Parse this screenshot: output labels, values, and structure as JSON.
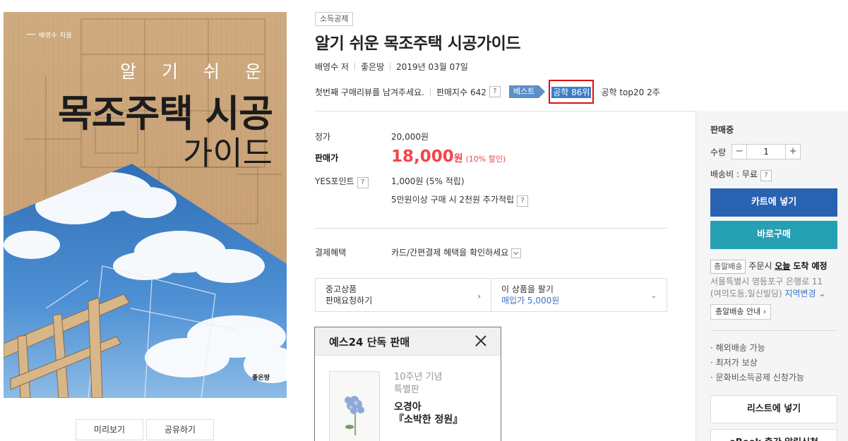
{
  "cover": {
    "author_line": "배영수 지음",
    "subtitle": "알 기 쉬 운",
    "title_line1": "목조주택 시공",
    "title_line2": "가이드",
    "publisher": "좋은땅"
  },
  "cover_buttons": {
    "preview": "미리보기",
    "share": "공유하기"
  },
  "product": {
    "tag": "소득공제",
    "title": "알기 쉬운 목조주택 시공가이드",
    "author": "배영수 저",
    "publisher": "좋은땅",
    "date": "2019년 03월 07일",
    "review_prompt": "첫번째 구매리뷰를 남겨주세요.",
    "sales_index": "판매지수 642",
    "best_label": "베스트",
    "rank": "공학 86위",
    "rank_top": "공학 top20 2주"
  },
  "price": {
    "list_label": "정가",
    "list_value": "20,000원",
    "sale_label": "판매가",
    "sale_amount": "18,000",
    "sale_unit": "원",
    "sale_rate": "(10% 할인)",
    "point_label": "YES포인트",
    "point_value": "1,000원 (5% 적립)",
    "extra_point": "5만원이상 구매 시 2천원 추가적립",
    "help": "?"
  },
  "payment": {
    "label": "결제혜택",
    "value": "카드/간편결제 혜택을 확인하세요"
  },
  "used": {
    "left_line1": "중고상품",
    "left_line2": "판매요청하기",
    "right_line1": "이 상품을 팔기",
    "right_line2": "매입가 5,000원"
  },
  "exclusive": {
    "header": "예스24 단독 판매",
    "annotation_line1": "10주년 기념",
    "annotation_line2": "특별판",
    "book_author": "오경아",
    "book_title": "『소박한 정원』"
  },
  "purchase": {
    "status": "판매중",
    "qty_label": "수량",
    "qty_value": "1",
    "minus": "−",
    "plus": "+",
    "shipping": "배송비 : 무료",
    "cart_button": "카트에 넣기",
    "buy_button": "바로구매",
    "delivery_chip": "총알배송",
    "delivery_pre": "주문시",
    "delivery_today": "오늘",
    "delivery_post": "도착 예정",
    "address_line1": "서울특별시 영등포구 은행로 11",
    "address_line2": "(여의도동,일신빌딩)",
    "address_change": "지역변경",
    "guide_button": "총알배송 안내",
    "benefits": [
      "해외배송 가능",
      "최저가 보상",
      "문화비소득공제 신청가능"
    ],
    "list_button": "리스트에 넣기",
    "ebook_button": "eBook 출간 알림신청"
  },
  "colors": {
    "accent_red": "#f2454a",
    "cart_blue": "#2962b0",
    "buy_teal": "#26a0b3",
    "rank_highlight": "#e01010"
  }
}
